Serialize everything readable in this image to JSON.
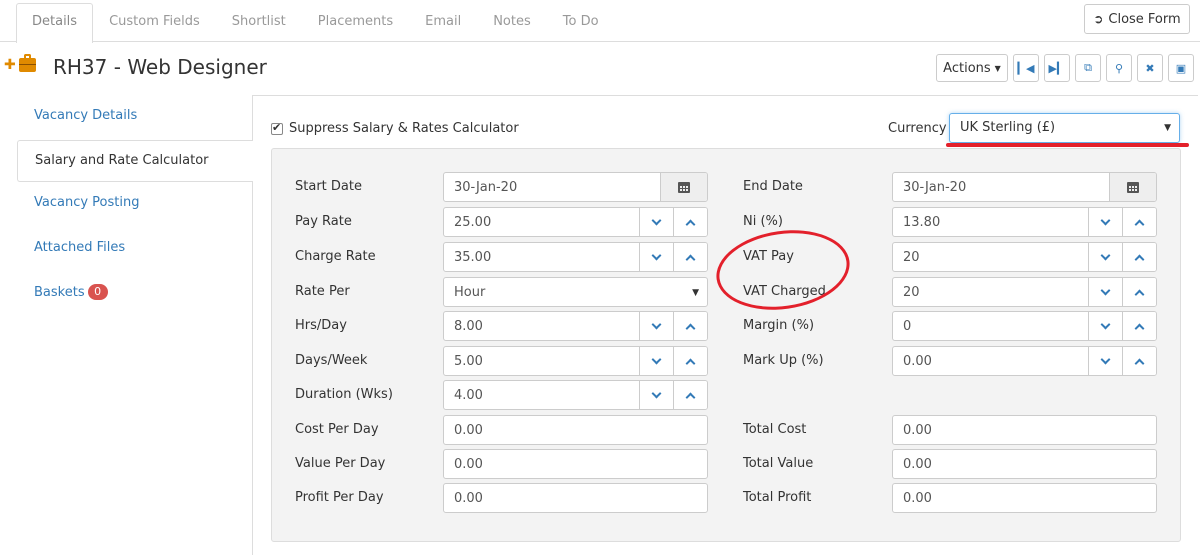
{
  "tabs": [
    "Details",
    "Custom Fields",
    "Shortlist",
    "Placements",
    "Email",
    "Notes",
    "To Do"
  ],
  "close_form": "Close Form",
  "header": {
    "title": "RH37 - Web Designer",
    "actions_label": "Actions"
  },
  "sidebar": {
    "items": [
      {
        "label": "Vacancy Details"
      },
      {
        "label": "Salary and Rate Calculator"
      },
      {
        "label": "Vacancy Posting"
      },
      {
        "label": "Attached Files"
      },
      {
        "label": "Baskets",
        "badge": "0"
      }
    ]
  },
  "main": {
    "suppress_label": "Suppress Salary & Rates Calculator",
    "suppress_checked": true,
    "currency_label": "Currency",
    "currency_value": "UK Sterling (£)",
    "left_fields": [
      {
        "label": "Start Date",
        "value": "30-Jan-20",
        "kind": "date"
      },
      {
        "label": "Pay Rate",
        "value": "25.00",
        "kind": "spin"
      },
      {
        "label": "Charge Rate",
        "value": "35.00",
        "kind": "spin"
      },
      {
        "label": "Rate Per",
        "value": "Hour",
        "kind": "select"
      },
      {
        "label": "Hrs/Day",
        "value": "8.00",
        "kind": "spin"
      },
      {
        "label": "Days/Week",
        "value": "5.00",
        "kind": "spin"
      },
      {
        "label": "Duration (Wks)",
        "value": "4.00",
        "kind": "spin"
      },
      {
        "label": "Cost Per Day",
        "value": "0.00",
        "kind": "text"
      },
      {
        "label": "Value Per Day",
        "value": "0.00",
        "kind": "text"
      },
      {
        "label": "Profit Per Day",
        "value": "0.00",
        "kind": "text"
      }
    ],
    "right_fields": [
      {
        "label": "End Date",
        "value": "30-Jan-20",
        "kind": "date"
      },
      {
        "label": "Ni (%)",
        "value": "13.80",
        "kind": "spin"
      },
      {
        "label": "VAT Pay",
        "value": "20",
        "kind": "spin"
      },
      {
        "label": "VAT Charged",
        "value": "20",
        "kind": "spin"
      },
      {
        "label": "Margin (%)",
        "value": "0",
        "kind": "spin"
      },
      {
        "label": "Mark Up (%)",
        "value": "0.00",
        "kind": "spin"
      },
      null,
      {
        "label": "Total Cost",
        "value": "0.00",
        "kind": "text"
      },
      {
        "label": "Total Value",
        "value": "0.00",
        "kind": "text"
      },
      {
        "label": "Total Profit",
        "value": "0.00",
        "kind": "text"
      }
    ]
  },
  "colors": {
    "link": "#337ab7",
    "badge": "#d9534f",
    "annotation": "#e3202b",
    "accent_icon": "#e08a00"
  }
}
